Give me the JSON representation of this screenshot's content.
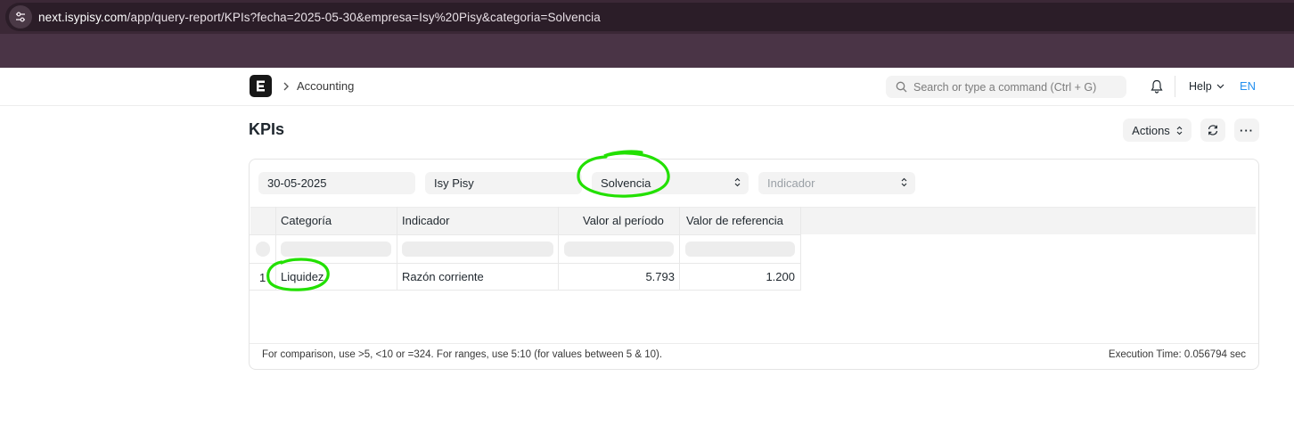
{
  "browser": {
    "url_host": "next.isypisy.com",
    "url_rest": "/app/query-report/KPIs?fecha=2025-05-30&empresa=Isy%20Pisy&categoria=Solvencia"
  },
  "navbar": {
    "breadcrumb": "Accounting",
    "search_placeholder": "Search or type a command (Ctrl + G)",
    "help_label": "Help",
    "language": "EN"
  },
  "page": {
    "title": "KPIs",
    "actions_label": "Actions",
    "more_label": "···"
  },
  "filters": {
    "fecha": "30-05-2025",
    "empresa": "Isy Pisy",
    "categoria": "Solvencia",
    "indicador_placeholder": "Indicador"
  },
  "table": {
    "columns": [
      "Categoría",
      "Indicador",
      "Valor al período",
      "Valor de referencia"
    ],
    "rows": [
      {
        "index": "1",
        "categoria": "Liquidez",
        "indicador": "Razón corriente",
        "valor": "5.793",
        "referencia": "1.200"
      }
    ]
  },
  "footer": {
    "hint": "For comparison, use >5, <10 or =324. For ranges, use 5:10 (for values between 5 & 10).",
    "execution_time": "Execution Time: 0.056794 sec"
  },
  "colors": {
    "accent": "#2490ef",
    "annotation": "#22e000"
  }
}
